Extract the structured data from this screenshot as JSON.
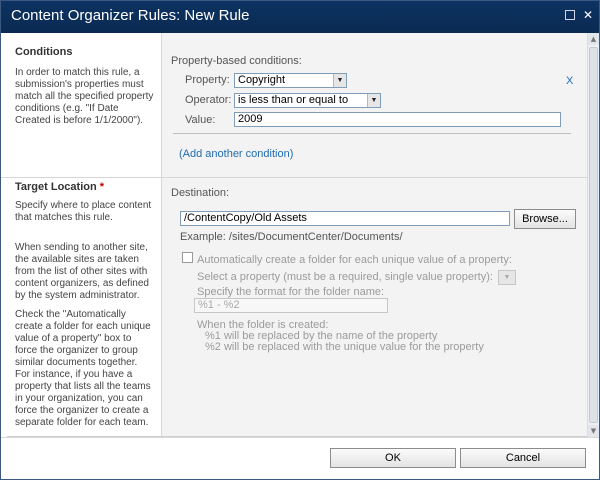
{
  "dialog": {
    "title": "Content Organizer Rules: New Rule"
  },
  "conditions": {
    "title": "Conditions",
    "description": "In order to match this rule, a submission's properties must match all the specified property conditions (e.g. \"If Date Created is before 1/1/2000\").",
    "header": "Property-based conditions:",
    "property_label": "Property:",
    "property_value": "Copyright",
    "operator_label": "Operator:",
    "operator_value": "is less than or equal to",
    "value_label": "Value:",
    "value_value": "2009",
    "remove_label": "X",
    "add_link": "(Add another condition)"
  },
  "target": {
    "title": "Target Location",
    "required_mark": "*",
    "desc1": "Specify where to place content that matches this rule.",
    "desc2": "When sending to another site, the available sites are taken from the list of other sites with content organizers, as defined by the system administrator.",
    "desc3": "Check the \"Automatically create a folder for each unique value of a property\" box to force the organizer to group similar documents together. For instance, if you have a property that lists all the teams in your organization, you can force the organizer to create a separate folder for each team.",
    "destination_label": "Destination:",
    "destination_value": "/ContentCopy/Old Assets",
    "browse_label": "Browse...",
    "example_text": "Example: /sites/DocumentCenter/Documents/",
    "auto_folder_label": "Automatically create a folder for each unique value of a property:",
    "select_property_label": "Select a property (must be a required, single value property):",
    "format_label": "Specify the format for the folder name:",
    "format_value": "%1 - %2",
    "when_label": "When the folder is created:",
    "replace1": "%1 will be replaced by the name of the property",
    "replace2": "%2 will be replaced with the unique value for the property"
  },
  "footer": {
    "ok_label": "OK",
    "cancel_label": "Cancel"
  },
  "colors": {
    "titlebar": "#0d3362",
    "link": "#1f6cb0",
    "required": "#bf0000"
  }
}
